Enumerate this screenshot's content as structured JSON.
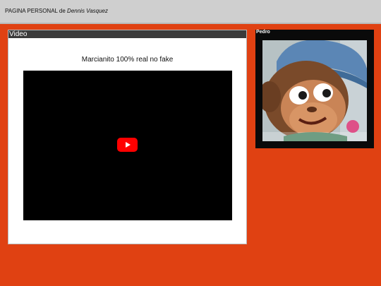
{
  "header": {
    "title_prefix": "PAGINA PERSONAL de ",
    "title_name": "Dennis Vasquez"
  },
  "video_panel": {
    "heading": "Video",
    "caption": "Marcianito 100% real no fake",
    "player_icon": "youtube-play-icon"
  },
  "side_panel": {
    "heading": "Pedro",
    "image_subject": "puppet-monkey-portrait"
  },
  "colors": {
    "page_background": "#e04112",
    "header_background": "#cfcfcf",
    "panel_bar": "#3b3b3b",
    "player_background": "#000000",
    "youtube_red": "#ff0000"
  }
}
